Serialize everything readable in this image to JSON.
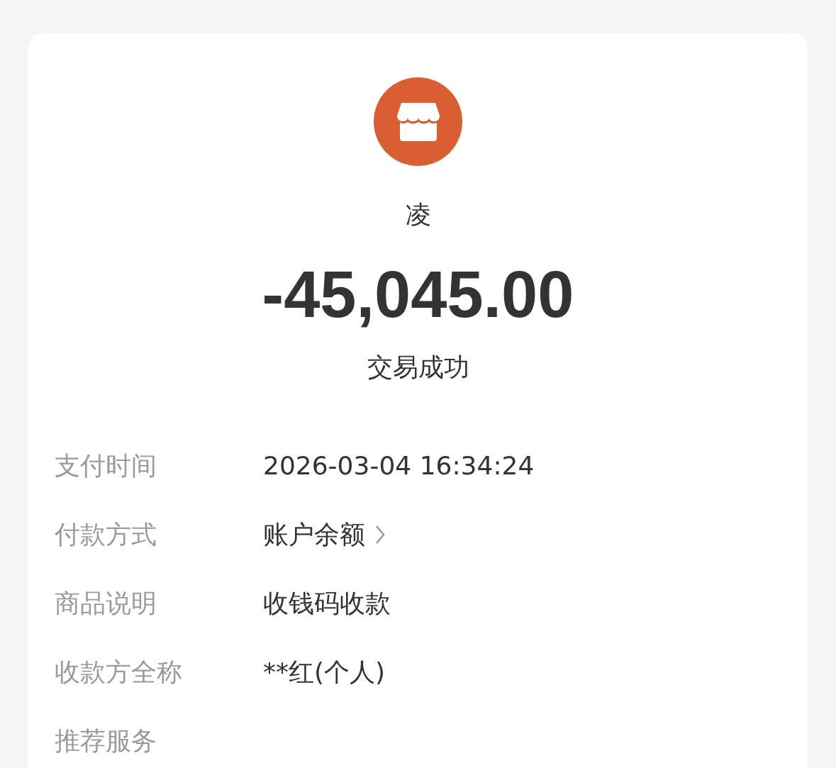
{
  "merchant": {
    "name": "凌"
  },
  "amount": "-45,045.00",
  "status": "交易成功",
  "details": [
    {
      "kind": "text",
      "label": "支付时间",
      "value": "2026-03-04 16:34:24"
    },
    {
      "kind": "link",
      "label": "付款方式",
      "value": "账户余额"
    },
    {
      "kind": "text",
      "label": "商品说明",
      "value": "收钱码收款"
    },
    {
      "kind": "text",
      "label": "收款方全称",
      "value": "**红(个人)"
    },
    {
      "kind": "header",
      "label": "推荐服务"
    }
  ]
}
